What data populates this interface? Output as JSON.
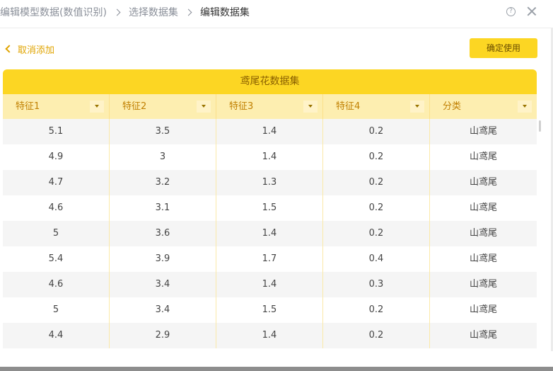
{
  "breadcrumb": {
    "items": [
      "编辑模型数据(数值识别)",
      "选择数据集",
      "编辑数据集"
    ]
  },
  "toolbar": {
    "back_label": "取消添加",
    "confirm_label": "确定使用",
    "help_icon": "?"
  },
  "table": {
    "title": "鸢尾花数据集",
    "columns": [
      "特征1",
      "特征2",
      "特征3",
      "特征4",
      "分类"
    ],
    "rows": [
      [
        "5.1",
        "3.5",
        "1.4",
        "0.2",
        "山鸢尾"
      ],
      [
        "4.9",
        "3",
        "1.4",
        "0.2",
        "山鸢尾"
      ],
      [
        "4.7",
        "3.2",
        "1.3",
        "0.2",
        "山鸢尾"
      ],
      [
        "4.6",
        "3.1",
        "1.5",
        "0.2",
        "山鸢尾"
      ],
      [
        "5",
        "3.6",
        "1.4",
        "0.2",
        "山鸢尾"
      ],
      [
        "5.4",
        "3.9",
        "1.7",
        "0.4",
        "山鸢尾"
      ],
      [
        "4.6",
        "3.4",
        "1.4",
        "0.3",
        "山鸢尾"
      ],
      [
        "5",
        "3.4",
        "1.5",
        "0.2",
        "山鸢尾"
      ],
      [
        "4.4",
        "2.9",
        "1.4",
        "0.2",
        "山鸢尾"
      ]
    ]
  },
  "colors": {
    "accent": "#fcd623",
    "header_bg": "#fdeeb0",
    "link": "#e0a400"
  }
}
